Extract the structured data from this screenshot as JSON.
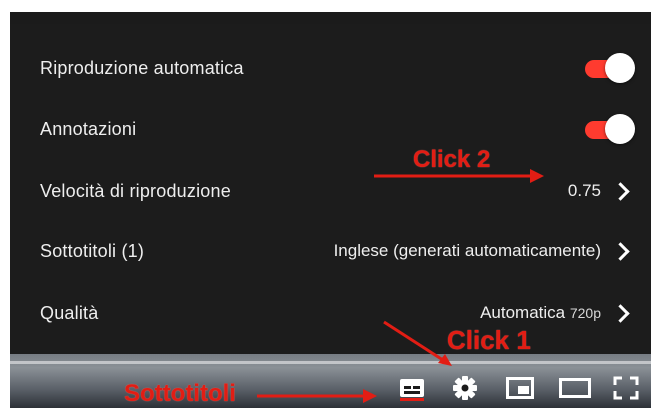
{
  "settings_menu": {
    "rows": [
      {
        "label": "Riproduzione automatica",
        "type": "toggle",
        "state": "on"
      },
      {
        "label": "Annotazioni",
        "type": "toggle",
        "state": "on"
      },
      {
        "label": "Velocità di riproduzione",
        "type": "value",
        "value": "0.75"
      },
      {
        "label": "Sottotitoli (1)",
        "type": "value",
        "value": "Inglese (generati automaticamente)"
      },
      {
        "label": "Qualità",
        "type": "value",
        "value": "Automatica",
        "value_suffix": "720p"
      }
    ]
  },
  "controls": {
    "icons": [
      "subtitles-icon",
      "settings-gear-icon",
      "miniplayer-icon",
      "theater-mode-icon",
      "fullscreen-icon"
    ]
  },
  "annotations": {
    "click1": "Click 1",
    "click2": "Click 2",
    "subtitles_callout": "Sottotitoli"
  },
  "colors": {
    "accent": "#ff3b2f",
    "annotation": "#e21d14",
    "menu_bg": "#1c1c1c"
  }
}
